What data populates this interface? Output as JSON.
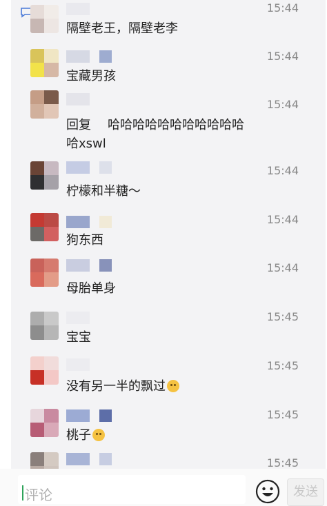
{
  "comments": [
    {
      "time": "15:44",
      "text": "隔壁老王，隔壁老李",
      "avatar_colors": [
        "#e6dcd8",
        "#f1ece8",
        "#c7b7b3",
        "#ede6e3"
      ],
      "name_colors": [
        "#e9e9ee"
      ]
    },
    {
      "time": "15:44",
      "text": "宝藏男孩",
      "avatar_colors": [
        "#d9c45a",
        "#f0e6c4",
        "#f2e24a",
        "#d6b8a6"
      ],
      "name_colors": [
        "#d6d9e4",
        "#9eacd0"
      ]
    },
    {
      "time": "15:44",
      "text_prefix": "回复",
      "text": "哈哈哈哈哈哈哈哈哈哈哈哈xswl",
      "avatar_colors": [
        "#c59d86",
        "#7a5a4a",
        "#d1b09c",
        "#e1c6b6"
      ],
      "name_colors": [
        "#e4e4ea"
      ]
    },
    {
      "time": "15:44",
      "text": "柠檬和半糖～",
      "avatar_colors": [
        "#6a4436",
        "#c7b9c1",
        "#2f2f31",
        "#a5a1a8"
      ],
      "name_colors": [
        "#c5cce4",
        "#dde0ea"
      ]
    },
    {
      "time": "15:44",
      "text": "狗东西",
      "avatar_colors": [
        "#c43a33",
        "#bb4a45",
        "#6c6a67",
        "#d26060"
      ],
      "name_colors": [
        "#99a6cc",
        "#f1ead7"
      ]
    },
    {
      "time": "15:44",
      "text": "母胎单身",
      "avatar_colors": [
        "#c9625a",
        "#d67b6f",
        "#d96a5c",
        "#e39c88"
      ],
      "name_colors": [
        "#c9cde0",
        "#8892ba"
      ]
    },
    {
      "time": "15:45",
      "text": "宝宝",
      "avatar_colors": [
        "#adadad",
        "#c9c9c9",
        "#8d8d8d",
        "#b6b6b6"
      ],
      "name_colors": [
        "#ececf0"
      ]
    },
    {
      "time": "15:45",
      "text": "没有另一半的飘过",
      "emoji": "thinking",
      "avatar_colors": [
        "#f3d0cc",
        "#f1dcdb",
        "#c73026",
        "#f3c8c6"
      ],
      "name_colors": [
        "#ececf0"
      ]
    },
    {
      "time": "15:45",
      "text": "桃子",
      "emoji": "blush",
      "avatar_colors": [
        "#e7d6dc",
        "#c98aa0",
        "#b75c75",
        "#d9a9b8"
      ],
      "name_colors": [
        "#9cabd4",
        "#5d6ea8"
      ]
    },
    {
      "time": "15:45",
      "text": "",
      "avatar_colors": [
        "#8a7f7b",
        "#d4cac2",
        "#b9aba4",
        "#cfc4bd"
      ],
      "name_colors": [
        "#a8b4d6",
        "#c7cde2"
      ]
    }
  ],
  "composer": {
    "placeholder": "评论",
    "send_label": "发送"
  }
}
